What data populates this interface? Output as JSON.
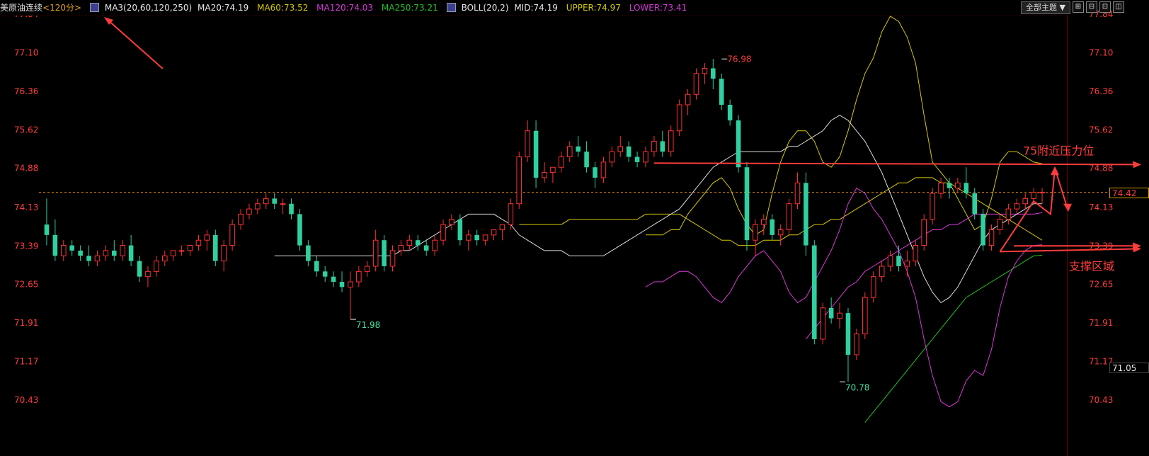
{
  "header": {
    "symbol": "美原油连续",
    "period": "<120分>",
    "ma_label": "MA3(20,60,120,250)",
    "ma20": "MA20:74.19",
    "ma60": "MA60:73.52",
    "ma120": "MA120:74.03",
    "ma250": "MA250:73.21",
    "boll_label": "BOLL(20,2)",
    "boll_mid": "MID:74.19",
    "boll_upper": "UPPER:74.97",
    "boll_lower": "LOWER:73.41"
  },
  "toolbar": {
    "theme_button": "全部主题",
    "btn_expand": "⊞",
    "btn_restore": "⊟",
    "btn_tile": "⊡",
    "btn_close": "◫"
  },
  "colors": {
    "up": "#ff3232",
    "down": "#2fd0a0",
    "ma20": "#dcdcdc",
    "ma60": "#d4c800",
    "ma120": "#d838d8",
    "ma250": "#20c020",
    "boll_upper": "#d4c800",
    "boll_lower": "#d838d8",
    "axis_text": "#ff3c3c",
    "annotation": "#ff3c3c"
  },
  "price_tags": {
    "current": "74.42",
    "low_tag": "71.05"
  },
  "chart_data": {
    "type": "candlestick",
    "y_axis_ticks": [
      "77.84",
      "77.10",
      "76.36",
      "75.62",
      "74.88",
      "74.13",
      "73.39",
      "72.65",
      "71.91",
      "71.17",
      "70.43"
    ],
    "ylim": [
      70.0,
      78.0
    ],
    "current_price": 74.42,
    "annotations": [
      {
        "label": "76.98",
        "price": 76.98,
        "bar": 80,
        "kind": "high"
      },
      {
        "label": "71.98",
        "price": 71.98,
        "bar": 36,
        "kind": "low"
      },
      {
        "label": "70.78",
        "price": 70.78,
        "bar": 94,
        "kind": "low"
      },
      {
        "label": "75附近压力位",
        "kind": "resistance",
        "price": 74.98,
        "from_bar": 72
      },
      {
        "label": "支撑区域",
        "kind": "support",
        "price": 73.28,
        "from_bar": 113
      }
    ],
    "ohlc": [
      [
        73.8,
        74.3,
        73.4,
        73.6
      ],
      [
        73.6,
        73.9,
        73.1,
        73.2
      ],
      [
        73.2,
        73.5,
        73.1,
        73.4
      ],
      [
        73.4,
        73.5,
        73.2,
        73.3
      ],
      [
        73.3,
        73.4,
        73.1,
        73.2
      ],
      [
        73.2,
        73.4,
        73.0,
        73.1
      ],
      [
        73.1,
        73.3,
        73.0,
        73.2
      ],
      [
        73.2,
        73.4,
        73.1,
        73.3
      ],
      [
        73.3,
        73.5,
        73.1,
        73.2
      ],
      [
        73.2,
        73.5,
        73.1,
        73.4
      ],
      [
        73.4,
        73.6,
        73.0,
        73.1
      ],
      [
        73.1,
        73.2,
        72.7,
        72.8
      ],
      [
        72.8,
        73.0,
        72.6,
        72.9
      ],
      [
        72.9,
        73.2,
        72.8,
        73.1
      ],
      [
        73.1,
        73.3,
        73.0,
        73.2
      ],
      [
        73.2,
        73.3,
        73.1,
        73.3
      ],
      [
        73.3,
        73.4,
        73.2,
        73.3
      ],
      [
        73.3,
        73.4,
        73.2,
        73.4
      ],
      [
        73.4,
        73.6,
        73.3,
        73.5
      ],
      [
        73.5,
        73.7,
        73.3,
        73.6
      ],
      [
        73.6,
        73.7,
        73.0,
        73.1
      ],
      [
        73.1,
        73.5,
        72.9,
        73.4
      ],
      [
        73.4,
        73.9,
        73.3,
        73.8
      ],
      [
        73.8,
        74.1,
        73.7,
        74.0
      ],
      [
        74.0,
        74.2,
        73.9,
        74.1
      ],
      [
        74.1,
        74.3,
        74.0,
        74.2
      ],
      [
        74.2,
        74.4,
        74.1,
        74.3
      ],
      [
        74.3,
        74.4,
        74.1,
        74.2
      ],
      [
        74.2,
        74.3,
        74.0,
        74.2
      ],
      [
        74.2,
        74.3,
        73.9,
        74.0
      ],
      [
        74.0,
        74.1,
        73.3,
        73.4
      ],
      [
        73.4,
        73.5,
        73.0,
        73.1
      ],
      [
        73.1,
        73.2,
        72.8,
        72.9
      ],
      [
        72.9,
        73.0,
        72.7,
        72.8
      ],
      [
        72.8,
        72.9,
        72.6,
        72.7
      ],
      [
        72.7,
        72.9,
        72.5,
        72.6
      ],
      [
        72.6,
        72.9,
        71.98,
        72.7
      ],
      [
        72.7,
        73.0,
        72.6,
        72.9
      ],
      [
        72.9,
        73.1,
        72.8,
        73.0
      ],
      [
        73.0,
        73.7,
        72.9,
        73.5
      ],
      [
        73.5,
        73.6,
        72.9,
        73.0
      ],
      [
        73.0,
        73.4,
        72.9,
        73.3
      ],
      [
        73.3,
        73.5,
        73.2,
        73.4
      ],
      [
        73.4,
        73.6,
        73.3,
        73.5
      ],
      [
        73.5,
        73.6,
        73.3,
        73.4
      ],
      [
        73.4,
        73.5,
        73.2,
        73.3
      ],
      [
        73.3,
        73.6,
        73.2,
        73.5
      ],
      [
        73.5,
        73.9,
        73.4,
        73.8
      ],
      [
        73.8,
        74.0,
        73.7,
        73.9
      ],
      [
        73.9,
        74.0,
        73.4,
        73.5
      ],
      [
        73.5,
        73.7,
        73.3,
        73.6
      ],
      [
        73.6,
        73.7,
        73.4,
        73.5
      ],
      [
        73.5,
        73.6,
        73.4,
        73.6
      ],
      [
        73.6,
        73.7,
        73.5,
        73.7
      ],
      [
        73.7,
        73.8,
        73.5,
        73.8
      ],
      [
        73.8,
        74.3,
        73.7,
        74.2
      ],
      [
        74.2,
        75.2,
        74.1,
        75.1
      ],
      [
        75.1,
        75.8,
        75.0,
        75.6
      ],
      [
        75.6,
        75.8,
        74.5,
        74.7
      ],
      [
        74.7,
        75.0,
        74.6,
        74.8
      ],
      [
        74.8,
        74.9,
        74.6,
        74.9
      ],
      [
        74.9,
        75.2,
        74.8,
        75.1
      ],
      [
        75.1,
        75.4,
        75.0,
        75.3
      ],
      [
        75.3,
        75.5,
        75.1,
        75.2
      ],
      [
        75.2,
        75.4,
        74.8,
        74.9
      ],
      [
        74.9,
        75.0,
        74.5,
        74.7
      ],
      [
        74.7,
        75.1,
        74.6,
        75.0
      ],
      [
        75.0,
        75.3,
        74.9,
        75.2
      ],
      [
        75.2,
        75.5,
        75.1,
        75.3
      ],
      [
        75.3,
        75.4,
        75.0,
        75.1
      ],
      [
        75.1,
        75.2,
        74.9,
        75.0
      ],
      [
        75.0,
        75.3,
        74.9,
        75.2
      ],
      [
        75.2,
        75.5,
        75.1,
        75.4
      ],
      [
        75.4,
        75.6,
        75.1,
        75.2
      ],
      [
        75.2,
        75.7,
        75.1,
        75.6
      ],
      [
        75.6,
        76.2,
        75.5,
        76.1
      ],
      [
        76.1,
        76.4,
        75.9,
        76.3
      ],
      [
        76.3,
        76.8,
        76.2,
        76.7
      ],
      [
        76.7,
        76.9,
        76.5,
        76.8
      ],
      [
        76.8,
        76.98,
        76.4,
        76.6
      ],
      [
        76.6,
        76.7,
        76.0,
        76.1
      ],
      [
        76.1,
        76.2,
        75.7,
        75.8
      ],
      [
        75.8,
        75.9,
        74.8,
        74.9
      ],
      [
        74.9,
        75.0,
        73.3,
        73.5
      ],
      [
        73.5,
        73.9,
        73.2,
        73.8
      ],
      [
        73.8,
        74.0,
        73.6,
        73.9
      ],
      [
        73.9,
        74.0,
        73.5,
        73.6
      ],
      [
        73.6,
        73.8,
        73.4,
        73.7
      ],
      [
        73.7,
        74.3,
        73.6,
        74.2
      ],
      [
        74.2,
        74.8,
        74.1,
        74.6
      ],
      [
        74.6,
        74.8,
        73.2,
        73.4
      ],
      [
        73.4,
        73.5,
        71.5,
        71.6
      ],
      [
        71.6,
        72.3,
        71.5,
        72.2
      ],
      [
        72.2,
        72.4,
        71.9,
        72.0
      ],
      [
        72.0,
        72.3,
        71.8,
        72.1
      ],
      [
        72.1,
        72.2,
        70.78,
        71.3
      ],
      [
        71.3,
        71.8,
        71.2,
        71.7
      ],
      [
        71.7,
        72.5,
        71.6,
        72.4
      ],
      [
        72.4,
        72.9,
        72.3,
        72.8
      ],
      [
        72.8,
        73.1,
        72.7,
        73.0
      ],
      [
        73.0,
        73.3,
        72.9,
        73.2
      ],
      [
        73.2,
        73.4,
        72.9,
        73.0
      ],
      [
        73.0,
        73.3,
        72.8,
        73.1
      ],
      [
        73.1,
        73.5,
        73.0,
        73.4
      ],
      [
        73.4,
        74.0,
        73.3,
        73.9
      ],
      [
        73.9,
        74.5,
        73.8,
        74.4
      ],
      [
        74.4,
        74.7,
        74.3,
        74.6
      ],
      [
        74.6,
        74.7,
        74.3,
        74.5
      ],
      [
        74.5,
        74.7,
        74.4,
        74.6
      ],
      [
        74.6,
        74.9,
        74.3,
        74.4
      ],
      [
        74.4,
        74.5,
        73.9,
        74.0
      ],
      [
        74.0,
        74.1,
        73.3,
        73.4
      ],
      [
        73.4,
        73.8,
        73.3,
        73.7
      ],
      [
        73.7,
        74.0,
        73.6,
        73.9
      ],
      [
        73.9,
        74.2,
        73.8,
        74.1
      ],
      [
        74.1,
        74.3,
        74.0,
        74.2
      ],
      [
        74.2,
        74.4,
        74.1,
        74.3
      ],
      [
        74.3,
        74.5,
        74.2,
        74.42
      ],
      [
        74.42,
        74.5,
        74.2,
        74.42
      ]
    ],
    "ma20": [
      73.2,
      73.2,
      73.2,
      73.2,
      73.2,
      73.2,
      73.2,
      73.2,
      73.2,
      73.2,
      73.2,
      73.2,
      73.2,
      73.2,
      73.2,
      73.3,
      73.3,
      73.4,
      73.5,
      73.6,
      73.7,
      73.8,
      73.9,
      74.0,
      74.0,
      74.0,
      74.0,
      73.9,
      73.8,
      73.6,
      73.5,
      73.4,
      73.3,
      73.3,
      73.3,
      73.2,
      73.2,
      73.2,
      73.2,
      73.2,
      73.3,
      73.4,
      73.5,
      73.6,
      73.7,
      73.8,
      73.9,
      74.0,
      74.1,
      74.3,
      74.5,
      74.7,
      74.9,
      75.0,
      75.1,
      75.2,
      75.2,
      75.2,
      75.2,
      75.2,
      75.2,
      75.3,
      75.3,
      75.4,
      75.5,
      75.6,
      75.8,
      75.9,
      75.8,
      75.6,
      75.4,
      75.1,
      74.8,
      74.4,
      74.0,
      73.6,
      73.2,
      72.8,
      72.5,
      72.3,
      72.4,
      72.6,
      72.9,
      73.2,
      73.5,
      73.7,
      73.8,
      73.9,
      74.0,
      74.1,
      74.2,
      74.2
    ],
    "ma60": [
      73.8,
      73.8,
      73.8,
      73.8,
      73.8,
      73.8,
      73.9,
      73.9,
      73.9,
      73.9,
      73.9,
      73.9,
      73.9,
      73.9,
      73.9,
      74.0,
      74.0,
      74.0,
      74.0,
      74.0,
      73.9,
      73.8,
      73.7,
      73.6,
      73.5,
      73.5,
      73.4,
      73.4,
      73.4,
      73.5,
      73.5,
      73.5,
      73.6,
      73.6,
      73.7,
      73.8,
      73.8,
      73.9,
      73.9,
      74.0,
      74.1,
      74.2,
      74.3,
      74.4,
      74.5,
      74.6,
      74.6,
      74.7,
      74.7,
      74.7,
      74.6,
      74.6,
      74.5,
      74.4,
      74.3,
      74.2,
      74.1,
      74.0,
      73.9,
      73.8,
      73.7,
      73.6,
      73.5
    ],
    "ma120": [
      71.6,
      71.8,
      72.0,
      72.2,
      72.4,
      72.6,
      72.7,
      72.9,
      73.0,
      73.1,
      73.2,
      73.3,
      73.4,
      73.5,
      73.6,
      73.7,
      73.7,
      73.8,
      73.8,
      73.9,
      74.0,
      74.0,
      74.0,
      74.0,
      74.0,
      74.0,
      74.0,
      74.0,
      74.03
    ],
    "ma250": [
      70.0,
      70.2,
      70.4,
      70.6,
      70.8,
      71.0,
      71.2,
      71.4,
      71.6,
      71.8,
      72.0,
      72.2,
      72.4,
      72.5,
      72.6,
      72.7,
      72.8,
      72.9,
      73.0,
      73.1,
      73.2,
      73.21
    ],
    "boll_upper": [
      73.6,
      73.6,
      73.6,
      73.7,
      73.7,
      74.0,
      74.2,
      74.4,
      74.6,
      74.7,
      74.5,
      74.1,
      73.8,
      73.6,
      73.7,
      74.4,
      75.0,
      75.4,
      75.6,
      75.6,
      75.4,
      75.0,
      74.9,
      75.1,
      75.6,
      76.2,
      76.7,
      77.0,
      77.5,
      77.8,
      77.7,
      77.4,
      76.9,
      75.9,
      75.0,
      74.8,
      74.6,
      74.3,
      74.0,
      73.7,
      73.8,
      74.3,
      75.0,
      75.2,
      75.2,
      75.1,
      75.0,
      74.97
    ],
    "boll_lower": [
      72.6,
      72.7,
      72.7,
      72.8,
      72.9,
      72.9,
      72.8,
      72.6,
      72.4,
      72.3,
      72.5,
      72.8,
      73.0,
      73.2,
      73.3,
      73.1,
      72.9,
      72.5,
      72.3,
      72.4,
      72.7,
      73.0,
      73.3,
      73.7,
      74.2,
      74.5,
      74.4,
      74.1,
      73.9,
      73.6,
      73.3,
      72.9,
      72.4,
      71.6,
      70.9,
      70.4,
      70.3,
      70.4,
      70.8,
      71.0,
      70.9,
      71.4,
      72.2,
      72.8,
      73.1,
      73.3,
      73.4,
      73.41
    ]
  }
}
